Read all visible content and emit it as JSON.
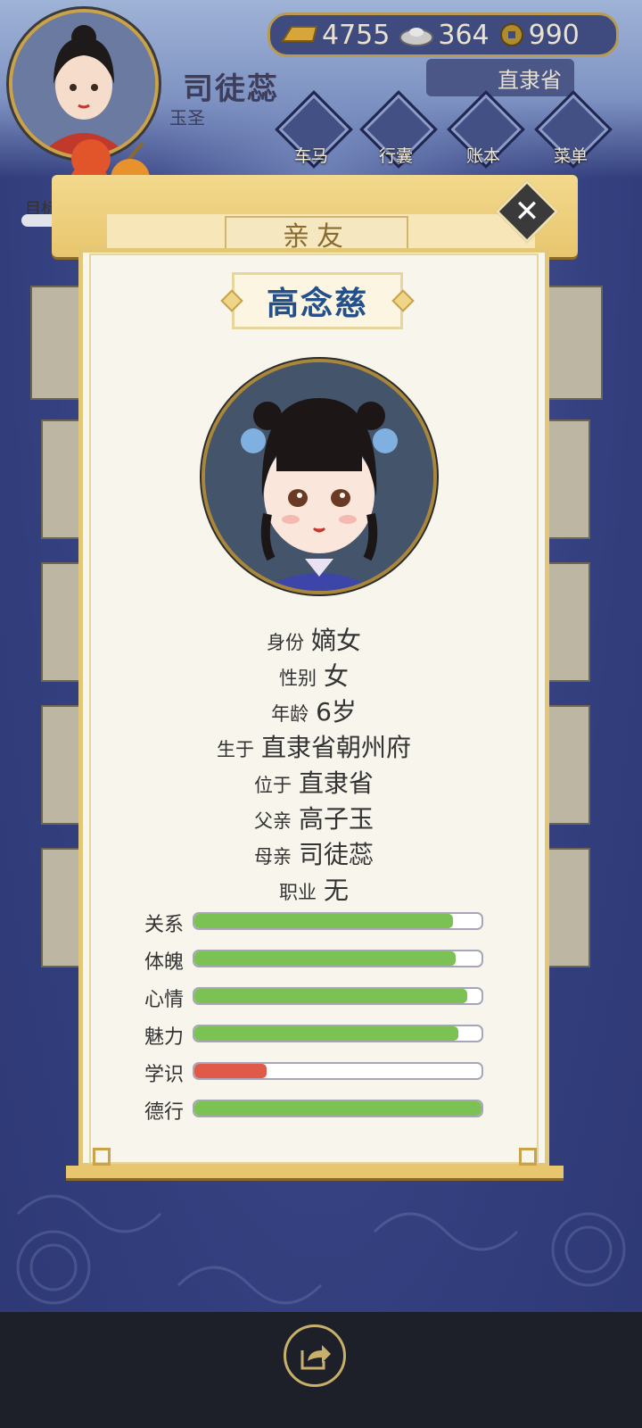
{
  "player": {
    "name": "司徒蕊",
    "title": "玉圣"
  },
  "currency": {
    "gold": "4755",
    "silver": "364",
    "coins": "990"
  },
  "location": "直隶省",
  "nav": [
    {
      "label": "车马",
      "icon": "carriage-icon"
    },
    {
      "label": "行囊",
      "icon": "bag-icon"
    },
    {
      "label": "账本",
      "icon": "ledger-icon"
    },
    {
      "label": "菜单",
      "icon": "more-icon"
    }
  ],
  "goal_label": "目标",
  "modal": {
    "tab_title": "亲友",
    "close_glyph": "✕",
    "person_name": "高念慈",
    "info": [
      {
        "key": "身份",
        "value": "嫡女"
      },
      {
        "key": "性别",
        "value": "女"
      },
      {
        "key": "年龄",
        "value": "6岁"
      },
      {
        "key": "生于",
        "value": "直隶省朝州府"
      },
      {
        "key": "位于",
        "value": "直隶省"
      },
      {
        "key": "父亲",
        "value": "高子玉"
      },
      {
        "key": "母亲",
        "value": "司徒蕊"
      },
      {
        "key": "职业",
        "value": "无"
      }
    ],
    "stats": [
      {
        "label": "关系",
        "value": 0.9,
        "color": "#7cc153"
      },
      {
        "label": "体魄",
        "value": 0.91,
        "color": "#7cc153"
      },
      {
        "label": "心情",
        "value": 0.95,
        "color": "#7cc153"
      },
      {
        "label": "魅力",
        "value": 0.92,
        "color": "#7cc153"
      },
      {
        "label": "学识",
        "value": 0.25,
        "color": "#e05a4a"
      },
      {
        "label": "德行",
        "value": 1.0,
        "color": "#7cc153"
      }
    ]
  },
  "colors": {
    "good": "#7cc153",
    "bad": "#e05a4a",
    "frame": "#e2c777",
    "name": "#24508a"
  }
}
